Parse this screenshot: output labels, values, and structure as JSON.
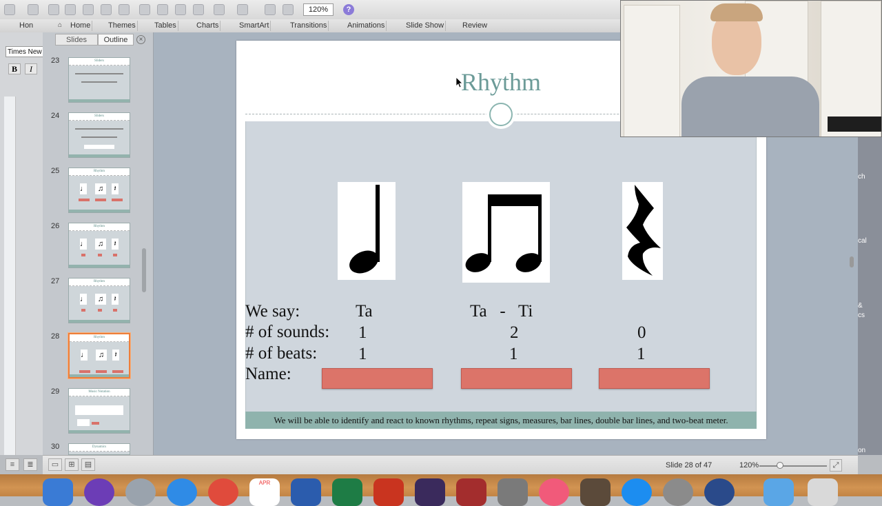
{
  "toolbar": {
    "zoom_value": "120%",
    "help_label": "?"
  },
  "ribbon": {
    "tabs": [
      "Home",
      "Themes",
      "Tables",
      "Charts",
      "SmartArt",
      "Transitions",
      "Animations",
      "Slide Show",
      "Review"
    ]
  },
  "left_strip": {
    "home_label": "Hon",
    "font_name": "Times New",
    "bold_label": "B",
    "italic_label": "I"
  },
  "slide_panel": {
    "segments": [
      "Slides",
      "Outline"
    ],
    "close_label": "×",
    "thumbnails": [
      {
        "number": "23",
        "title": "Sliders"
      },
      {
        "number": "24",
        "title": "Sliders"
      },
      {
        "number": "25",
        "title": "Rhythm"
      },
      {
        "number": "26",
        "title": "Rhythm"
      },
      {
        "number": "27",
        "title": "Rhythm"
      },
      {
        "number": "28",
        "title": "Rhythm",
        "selected": true
      },
      {
        "number": "29",
        "title": "Music Notation"
      },
      {
        "number": "30",
        "title": "Dynamics"
      }
    ]
  },
  "slide": {
    "title": "Rhythm",
    "labels": {
      "we_say": "We say:",
      "num_sounds": "# of sounds:",
      "num_beats": "# of beats:",
      "name": "Name:"
    },
    "columns": [
      {
        "we_say": "Ta",
        "sounds": "1",
        "beats": "1"
      },
      {
        "we_say": "Ta   -   Ti",
        "sounds": "2",
        "beats": "1"
      },
      {
        "we_say": "",
        "sounds": "0",
        "beats": "1"
      }
    ],
    "footer": "We will be able to identify and react to known rhythms, repeat signs, measures, bar lines, double bar lines, and two-beat meter."
  },
  "right_edge": {
    "labels": [
      "ch",
      "cal",
      "&",
      "cs",
      "on"
    ]
  },
  "statusbar": {
    "slide_count": "Slide 28 of 47",
    "zoom": "120%"
  },
  "dock": {
    "calendar_month": "APR"
  },
  "colors": {
    "title_teal": "#6c9b98",
    "name_bar": "#dc7469",
    "footer_band": "#8fb3ad",
    "selected_thumb": "#ee7e3a"
  }
}
